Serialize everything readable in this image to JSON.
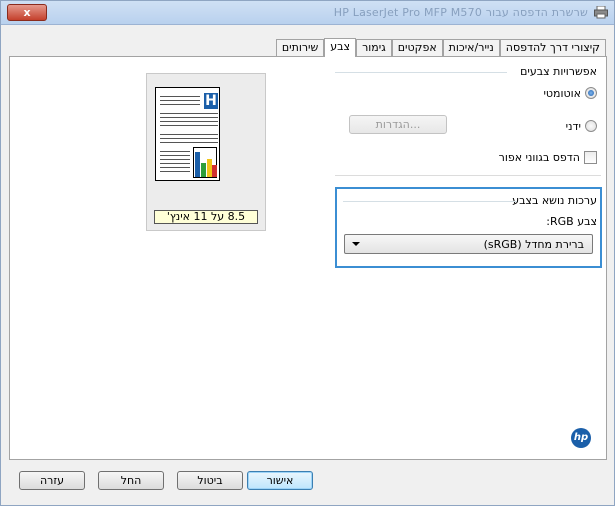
{
  "titlebar": {
    "title": "שרשרת הדפסה עבור HP LaserJet Pro MFP M570",
    "close_symbol": "x"
  },
  "tabs": [
    {
      "label": "קיצורי דרך להדפסה"
    },
    {
      "label": "נייר/איכות"
    },
    {
      "label": "אפקטים"
    },
    {
      "label": "גימור"
    },
    {
      "label": "צבע"
    },
    {
      "label": "שירותים"
    }
  ],
  "color_options": {
    "title": "אפשרויות צבעים",
    "automatic_label": "אוטומטי",
    "manual_label": "ידני",
    "settings_button": "הגדרות...",
    "grayscale_label": "הדפס בגווני אפור"
  },
  "color_themes": {
    "title": "ערכות נושא בצבע",
    "rgb_label": "צבע RGB:",
    "rgb_selected": "ברירת מחדל (sRGB)"
  },
  "preview": {
    "size_label": "8.5 על 11 אינץ'"
  },
  "hp_logo": "hp",
  "buttons": {
    "ok": "אישור",
    "cancel": "ביטול",
    "apply": "החל",
    "help": "עזרה"
  },
  "colors": {
    "accent": "#3b8ed3",
    "hp_blue": "#1b5fa9"
  }
}
